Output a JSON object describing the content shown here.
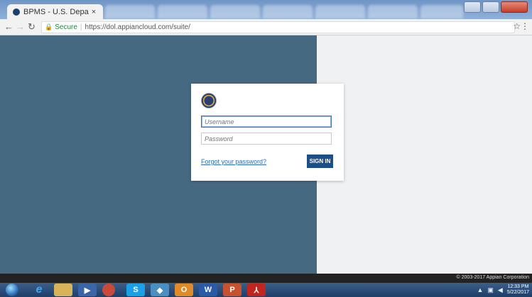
{
  "browser": {
    "tab_title": "BPMS - U.S. Departmen",
    "tab_close": "×",
    "secure_label": "Secure",
    "url": "https://dol.appiancloud.com/suite/"
  },
  "login": {
    "username_placeholder": "Username",
    "password_placeholder": "Password",
    "forgot_label": "Forgot your password?",
    "signin_label": "SIGN IN"
  },
  "footer": {
    "copyright": "© 2003-2017 Appian Corporation"
  },
  "taskbar": {
    "time": "12:33 PM",
    "date": "5/22/2017"
  },
  "colors": {
    "left_panel": "#466982",
    "button": "#1d4e87",
    "link": "#2b6ac1"
  }
}
